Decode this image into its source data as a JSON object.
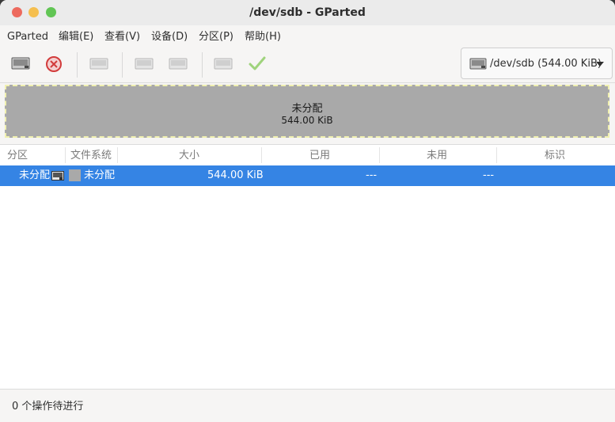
{
  "window": {
    "title": "/dev/sdb - GParted"
  },
  "menu": [
    "GParted",
    "编辑(E)",
    "查看(V)",
    "设备(D)",
    "分区(P)",
    "帮助(H)"
  ],
  "toolbar": {
    "buttons": [
      "new-partition",
      "delete-partition",
      "resize-move",
      "copy",
      "paste",
      "undo",
      "apply"
    ],
    "device_selector": "/dev/sdb (544.00 KiB)"
  },
  "disk_map": {
    "name": "未分配",
    "size": "544.00 KiB"
  },
  "table": {
    "columns": [
      "分区",
      "文件系统",
      "大小",
      "已用",
      "未用",
      "标识"
    ],
    "rows": [
      {
        "partition": "未分配",
        "filesystem": "未分配",
        "size": "544.00 KiB",
        "used": "---",
        "unused": "---",
        "flags": ""
      }
    ],
    "selection_color": "#3584e4"
  },
  "status": {
    "text": "0 个操作待进行"
  }
}
